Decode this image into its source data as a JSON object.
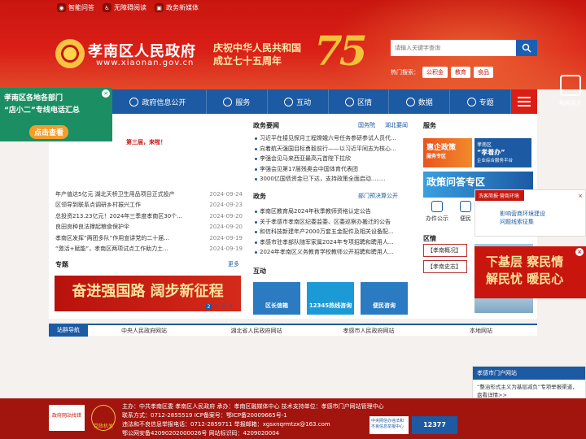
{
  "top_links": [
    "智能问答",
    "无障碍阅读",
    "政务新媒体"
  ],
  "site": {
    "title": "孝南区人民政府",
    "url": "www.xiaonan.gov.cn",
    "slogan1": "庆祝中华人民共和国",
    "slogan2": "成立七十五周年",
    "badge": "75"
  },
  "search": {
    "placeholder": "请输入关键字查询",
    "hot_label": "热门搜索：",
    "hot_tags": [
      "公积金",
      "教育",
      "食品"
    ]
  },
  "expand_label": "触屏展开",
  "nav": [
    "新闻",
    "政府信息公开",
    "服务",
    "互动",
    "区情",
    "数据",
    "专题"
  ],
  "float_left": {
    "line1": "孝南区各地各部门",
    "line2": "“店小二”专线电话汇总",
    "button": "点击查看",
    "close": "×"
  },
  "promo_text": "第三届，来啦！",
  "news": [
    {
      "title": "年产值达5亿元 湖北天桥卫生用品项目正式投产",
      "date": "2024-09-24"
    },
    {
      "title": "区领导到联系点调研乡村振兴工作",
      "date": "2024-09-23"
    },
    {
      "title": "总投资213.23亿元！2024年三季度孝南区30个...",
      "date": "2024-09-20"
    },
    {
      "title": "良田良种良法撑起粮食保护伞",
      "date": "2024-09-20"
    },
    {
      "title": "孝南区发挥“两团多队”作用宣讲党的二十届...",
      "date": "2024-09-19"
    },
    {
      "title": "“激活+赋能”，孝南区两项试点工作助力土...",
      "date": "2024-09-19"
    }
  ],
  "zhuanti": {
    "title": "专题",
    "more": "更多",
    "banner": "奋进强国路 阔步新征程",
    "pages": [
      "1",
      "2",
      "3",
      "4",
      "5"
    ]
  },
  "zhengwu": {
    "title": "政务要闻",
    "tab1": "国务院",
    "tab2": "湖北要闻",
    "items": [
      "习近平在接见探月工程嫦娥六号任务参研参试人员代...",
      "向着航天强国目标勇毅前行——以习近平同志为核心...",
      "李强会见马来西亚最高元首陛下拉欣",
      "李强会见第17届残奥会中国体育代表团",
      "3000亿国债资金已下达，支持政策全面启动........"
    ]
  },
  "zhengwu2": {
    "title": "政务",
    "tab": "部门预决算公开",
    "items": [
      "孝南区教育局2024年秋季教师资格认定公告",
      "关于孝感市孝南区纪委监委、区委巡察办搬迁的公告",
      "和信科技新建年产2000万套五金配件及相关设备配...",
      "孝感市驻孝部队随军家属2024年专项招聘和聘用人...",
      "2024年孝南区义务教育学校教师公开招聘和聘用人..."
    ]
  },
  "hudong": {
    "title": "互动",
    "buttons": [
      "区长信箱",
      "12345热线咨询",
      "便民咨询"
    ]
  },
  "fuwu": {
    "title": "服务",
    "img1": "惠企政策",
    "img1_sub": "服务专区",
    "img2_top": "孝南区",
    "img2_main": "“孝着办”",
    "img2_sub": "企业综合服务平台",
    "img3": "政策问答专区",
    "svc": [
      "办件公示",
      "便民"
    ]
  },
  "quqing": {
    "title": "区情",
    "tags": [
      "【孝南概况】",
      "【孝南史志】"
    ]
  },
  "float_right1": {
    "header": "洗客简报·营商环境",
    "text1": "影响营商环境建设",
    "text2": "问题线索征集",
    "close": "×"
  },
  "float_right2": {
    "line1": "下基层 察民情",
    "line2": "解民忧 暖民心",
    "close": "×"
  },
  "site_nav": {
    "label": "站群导航",
    "options": [
      "中央人民政府网站",
      "湖北省人民政府网站",
      "孝感市人民政府网站",
      "本地网站"
    ]
  },
  "portal": {
    "header": "孝感市门户网站",
    "text": "“整治形式主义为基层减负”专项举报渠道，盘看详情>>"
  },
  "footer": {
    "line1": "主办：中共孝南区委 孝南区人民政府    承办：孝南区融媒体中心    技术支持单位：孝感市门户网站管理中心",
    "line2": "联系方式：0712-2855519    ICP备案号：鄂ICP备20009665号-1",
    "line3": "违法和不良信息举报电话：0712-2859711    举报邮箱：xgsxnqrmtzx@163.com",
    "line4": "鄂公网安备42090202000026号    网站标识码：4209020004",
    "logo1": "政府网站找错",
    "logo2": "党政机关",
    "logo3": "中央网信办违法和不良信息举报中心",
    "logo4": "12377"
  },
  "colors": {
    "red": "#c8160f",
    "blue": "#1c5aa3",
    "gold": "#f3c23a"
  }
}
